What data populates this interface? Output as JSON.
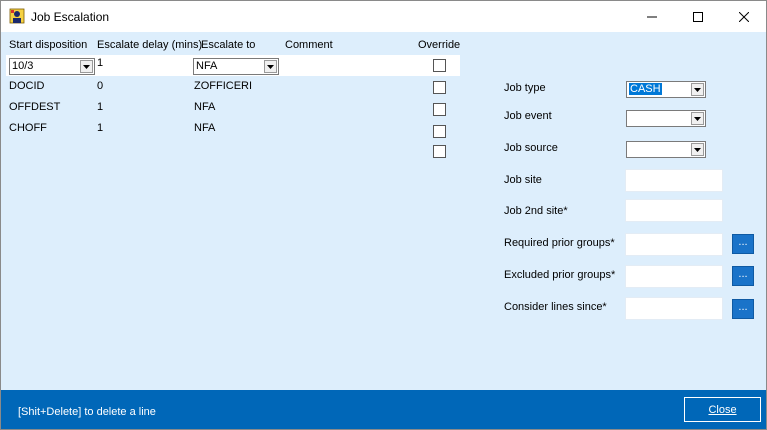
{
  "window": {
    "title": "Job Escalation",
    "icons": {
      "app": "app-logo-icon",
      "minimize": "minimize-icon",
      "maximize": "maximize-icon",
      "close": "close-icon"
    }
  },
  "grid": {
    "headers": {
      "start_disposition": "Start disposition",
      "escalate_delay": "Escalate delay (mins)",
      "escalate_to": "Escalate to",
      "comment": "Comment",
      "override": "Override"
    },
    "rows": [
      {
        "start": "10/3",
        "delay": "1",
        "to": "NFA",
        "comment": "",
        "override": false
      },
      {
        "start": "DOCID",
        "delay": "0",
        "to": "ZOFFICERI",
        "comment": "",
        "override": false
      },
      {
        "start": "OFFDEST",
        "delay": "1",
        "to": "NFA",
        "comment": "",
        "override": false
      },
      {
        "start": "CHOFF",
        "delay": "1",
        "to": "NFA",
        "comment": "",
        "override": false
      },
      {
        "start": "",
        "delay": "",
        "to": "",
        "comment": "",
        "override": false
      }
    ]
  },
  "form": {
    "job_type": {
      "label": "Job type",
      "value": "CASH"
    },
    "job_event": {
      "label": "Job event",
      "value": ""
    },
    "job_source": {
      "label": "Job source",
      "value": ""
    },
    "job_site": {
      "label": "Job site",
      "value": ""
    },
    "job_2nd_site": {
      "label": "Job 2nd site*",
      "value": ""
    },
    "required_prior_groups": {
      "label": "Required prior groups*",
      "value": "",
      "button": "..."
    },
    "excluded_prior_groups": {
      "label": "Excluded prior groups*",
      "value": "",
      "button": "..."
    },
    "consider_lines_since": {
      "label": "Consider lines since*",
      "value": "",
      "button": "..."
    }
  },
  "footer": {
    "hint": "[Shit+Delete] to delete a line",
    "close_label": "Close"
  },
  "colors": {
    "footer_bg": "#0067b8",
    "content_bg": "#ddeefc",
    "selection": "#0078d7",
    "dots_button": "#1a73c9"
  }
}
